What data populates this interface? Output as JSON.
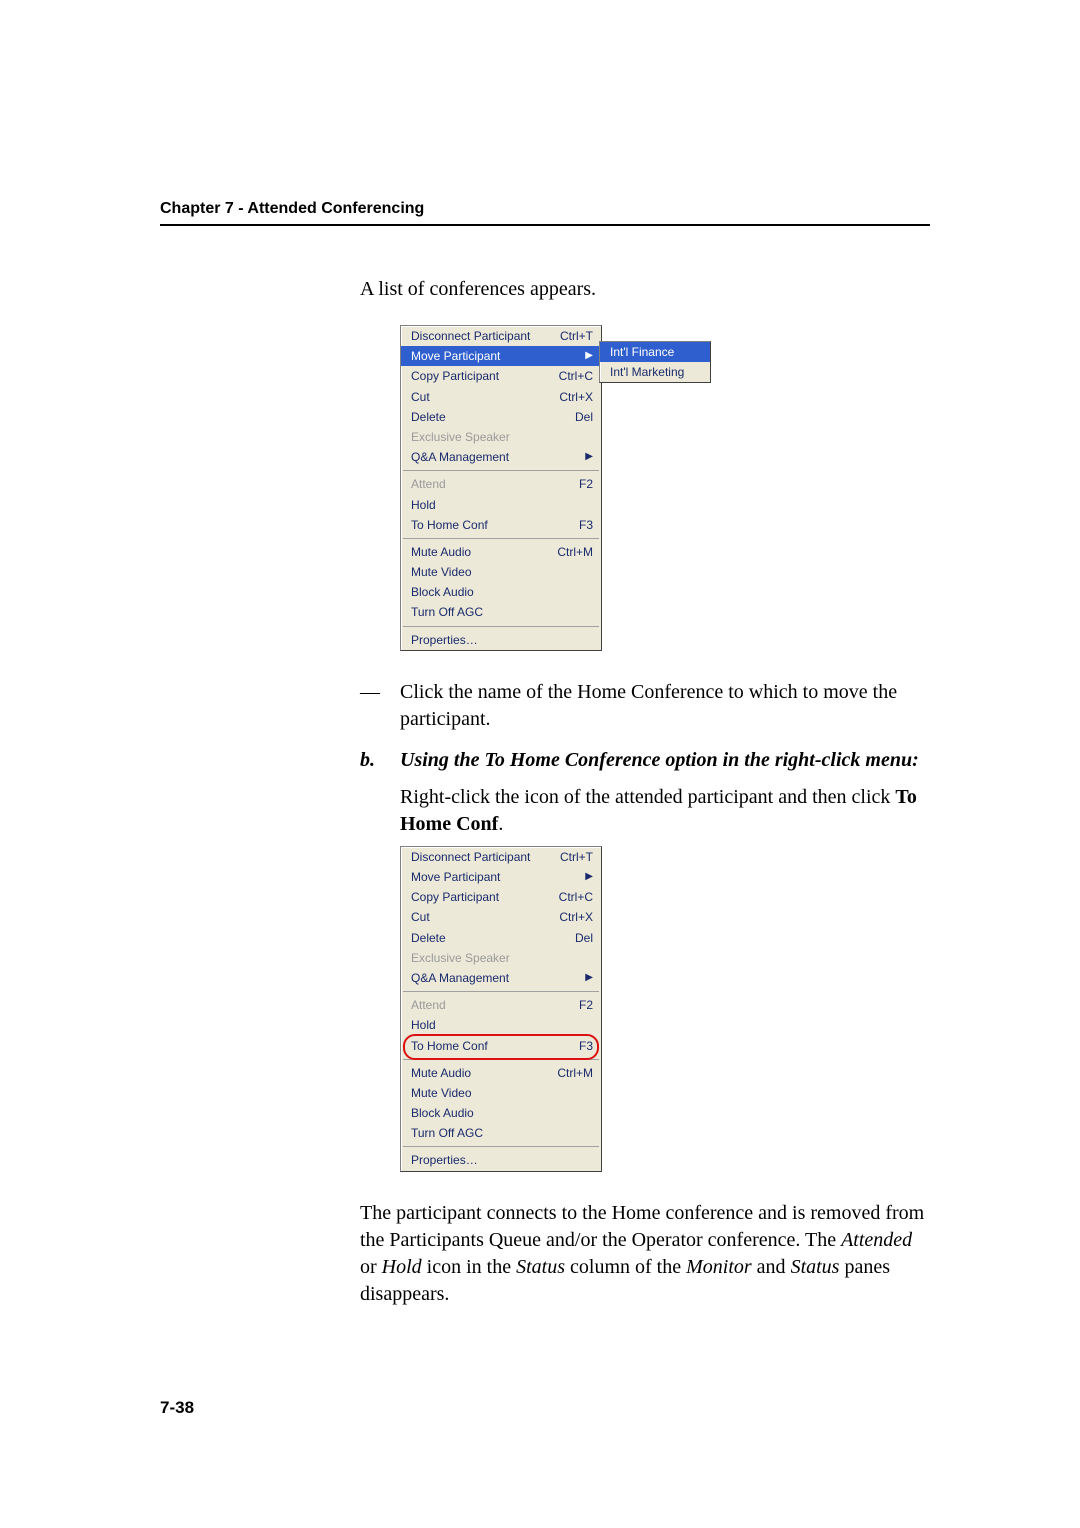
{
  "header": {
    "chapter": "Chapter 7 - Attended Conferencing"
  },
  "body": {
    "intro": "A list of conferences appears.",
    "click_desc_prefix": "— ",
    "click_desc": "Click the name of the Home Conference to which to move the participant.",
    "step_b_label": "b.",
    "step_b_title": "Using the To Home Conference option in the right-click menu:",
    "step_b_para_pre": "Right-click the icon of the attended participant and then click ",
    "step_b_para_bold": "To Home Conf",
    "step_b_para_post": ".",
    "conclusion_1": "The participant connects to the Home conference and is removed from the Participants Queue and/or the Operator conference. The ",
    "conclusion_i1": "Attended",
    "conclusion_2": " or ",
    "conclusion_i2": "Hold",
    "conclusion_3": " icon in the ",
    "conclusion_i3": "Status",
    "conclusion_4": " column of the ",
    "conclusion_i4": "Monitor",
    "conclusion_5": " and ",
    "conclusion_i5": "Status",
    "conclusion_6": " panes disappears."
  },
  "menu": {
    "items_top": [
      {
        "label": "Disconnect Participant",
        "shortcut": "Ctrl+T"
      },
      {
        "label": "Move Participant",
        "shortcut": "",
        "submenu": true
      },
      {
        "label": "Copy Participant",
        "shortcut": "Ctrl+C"
      },
      {
        "label": "Cut",
        "shortcut": "Ctrl+X"
      },
      {
        "label": "Delete",
        "shortcut": "Del"
      },
      {
        "label": "Exclusive Speaker",
        "shortcut": "",
        "disabled": true
      },
      {
        "label": "Q&A Management",
        "shortcut": "",
        "submenu": true
      }
    ],
    "items_mid": [
      {
        "label": "Attend",
        "shortcut": "F2",
        "disabled": true
      },
      {
        "label": "Hold",
        "shortcut": ""
      },
      {
        "label": "To Home Conf",
        "shortcut": "F3"
      }
    ],
    "items_av": [
      {
        "label": "Mute Audio",
        "shortcut": "Ctrl+M"
      },
      {
        "label": "Mute Video",
        "shortcut": ""
      },
      {
        "label": "Block Audio",
        "shortcut": ""
      },
      {
        "label": "Turn Off AGC",
        "shortcut": ""
      }
    ],
    "items_bottom": [
      {
        "label": "Properties…",
        "shortcut": ""
      }
    ],
    "submenu_items": [
      {
        "label": "Int'l Finance"
      },
      {
        "label": "Int'l Marketing"
      }
    ]
  },
  "page_number": "7-38"
}
